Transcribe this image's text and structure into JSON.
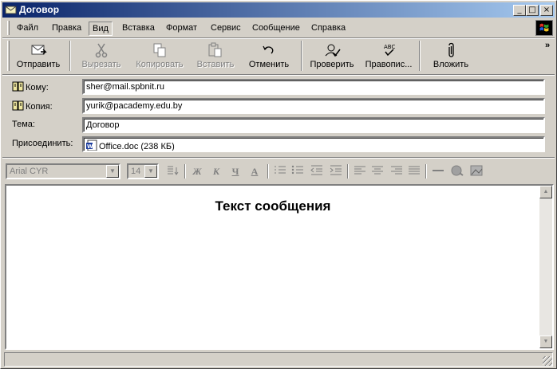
{
  "window": {
    "title": "Договор",
    "controls": {
      "minimize": "_",
      "maximize": "□",
      "close": "×"
    }
  },
  "menu": {
    "items": [
      {
        "label": "Файл",
        "active": false
      },
      {
        "label": "Правка",
        "active": false
      },
      {
        "label": "Вид",
        "active": true
      },
      {
        "label": "Вставка",
        "active": false
      },
      {
        "label": "Формат",
        "active": false
      },
      {
        "label": "Сервис",
        "active": false
      },
      {
        "label": "Сообщение",
        "active": false
      },
      {
        "label": "Справка",
        "active": false
      }
    ]
  },
  "toolbar": {
    "send": "Отправить",
    "cut": "Вырезать",
    "copy": "Копировать",
    "paste": "Вставить",
    "undo": "Отменить",
    "check": "Проверить",
    "spelling": "Правопис...",
    "attach": "Вложить",
    "more": "»"
  },
  "fields": {
    "to": {
      "label": "Кому:",
      "value": "sher@mail.spbnit.ru"
    },
    "cc": {
      "label": "Копия:",
      "value": "yurik@pacademy.edu.by"
    },
    "subject": {
      "label": "Тема:",
      "value": "Договор"
    },
    "attach": {
      "label": "Присоединить:",
      "value": "Office.doc (238 КБ)"
    }
  },
  "format": {
    "font": "Arial CYR",
    "size": "14",
    "bold": "Ж",
    "italic": "К",
    "underline": "Ч",
    "color": "A"
  },
  "body": {
    "text": "Текст сообщения"
  },
  "colors": {
    "titlebar_start": "#0a246a",
    "titlebar_end": "#a6caf0",
    "face": "#d4d0c8"
  }
}
